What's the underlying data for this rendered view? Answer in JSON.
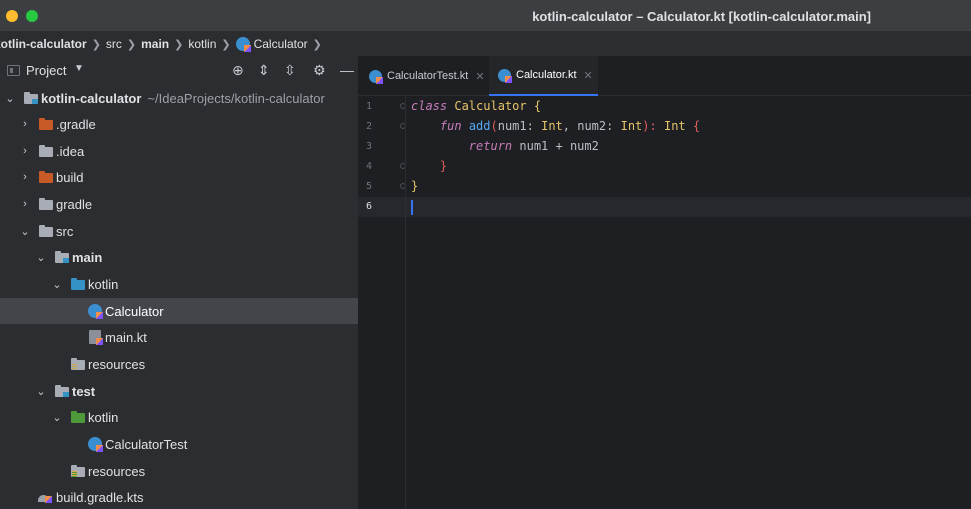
{
  "window": {
    "title": "kotlin-calculator – Calculator.kt [kotlin-calculator.main]"
  },
  "breadcrumb": {
    "items": [
      "kotlin-calculator",
      "src",
      "main",
      "kotlin",
      "Calculator"
    ]
  },
  "project_panel": {
    "title": "Project",
    "tools": [
      "target-icon",
      "expand-all-icon",
      "collapse-all-icon",
      "gear-icon",
      "minimize-icon"
    ],
    "tree": [
      {
        "label": "kotlin-calculator",
        "hint": "~/IdeaProjects/kotlin-calculator",
        "icon": "module-folder-icon"
      },
      {
        "label": ".gradle",
        "icon": "excluded-folder-icon"
      },
      {
        "label": ".idea",
        "icon": "folder-icon"
      },
      {
        "label": "build",
        "icon": "excluded-folder-icon"
      },
      {
        "label": "gradle",
        "icon": "folder-icon"
      },
      {
        "label": "src",
        "icon": "folder-icon"
      },
      {
        "label": "main",
        "icon": "module-folder-icon"
      },
      {
        "label": "kotlin",
        "icon": "source-folder-icon"
      },
      {
        "label": "Calculator",
        "icon": "kotlin-class-icon",
        "selected": true
      },
      {
        "label": "main.kt",
        "icon": "kotlin-file-icon"
      },
      {
        "label": "resources",
        "icon": "resources-folder-icon"
      },
      {
        "label": "test",
        "icon": "module-folder-icon"
      },
      {
        "label": "kotlin",
        "icon": "test-source-folder-icon"
      },
      {
        "label": "CalculatorTest",
        "icon": "kotlin-class-icon"
      },
      {
        "label": "resources",
        "icon": "test-resources-folder-icon"
      },
      {
        "label": "build.gradle.kts",
        "icon": "gradle-kotlin-icon"
      }
    ]
  },
  "editor": {
    "tabs": [
      {
        "label": "CalculatorTest.kt",
        "active": false
      },
      {
        "label": "Calculator.kt",
        "active": true
      }
    ],
    "line_numbers": [
      "1",
      "2",
      "3",
      "4",
      "5",
      "6"
    ],
    "current_line": "6",
    "code": {
      "l1_kw": "class",
      "l1_name": " Calculator ",
      "l1_brace": "{",
      "l2_indent": "    ",
      "l2_kw": "fun",
      "l2_fn": " add",
      "l2_open": "(",
      "l2_p1": "num1",
      "l2_c1": ": ",
      "l2_t1": "Int",
      "l2_comma": ", ",
      "l2_p2": "num2",
      "l2_c2": ": ",
      "l2_t2": "Int",
      "l2_close": "): ",
      "l2_rt": "Int",
      "l2_brace": " {",
      "l3_indent": "        ",
      "l3_kw": "return",
      "l3_expr": " num1 + num2",
      "l4_indent": "    ",
      "l4_brace": "}",
      "l5_brace": "}"
    }
  },
  "colors": {
    "accent": "#3574f0",
    "background": "#1e1f22",
    "panel": "#2b2d30"
  }
}
